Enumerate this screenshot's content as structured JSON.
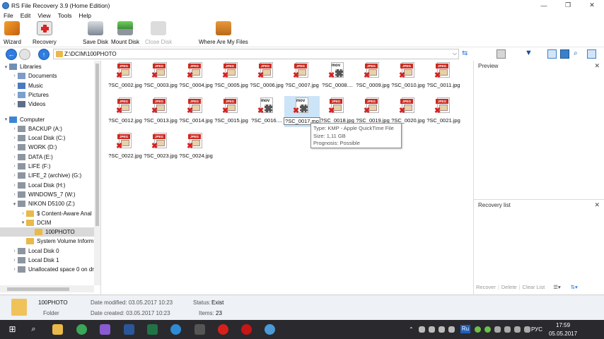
{
  "window": {
    "title": "RS File Recovery 3.9 (Home Edition)"
  },
  "menu": [
    "File",
    "Edit",
    "View",
    "Tools",
    "Help"
  ],
  "toolbar": {
    "wizard": "Wizard",
    "recovery": "Recovery",
    "save_disk": "Save Disk",
    "mount_disk": "Mount Disk",
    "close_disk": "Close Disk",
    "where_files": "Where Are My Files"
  },
  "address": {
    "path": "Z:\\DCIM\\100PHOTO"
  },
  "tree": [
    {
      "label": "Libraries",
      "arrow": "▾",
      "icon": "libraries-icon"
    },
    {
      "label": "Documents",
      "arrow": "›",
      "icon": "documents-icon"
    },
    {
      "label": "Music",
      "arrow": "›",
      "icon": "music-icon"
    },
    {
      "label": "Pictures",
      "arrow": "›",
      "icon": "pictures-icon"
    },
    {
      "label": "Videos",
      "arrow": "›",
      "icon": "videos-icon"
    },
    {
      "label": "Computer",
      "arrow": "▾",
      "icon": "computer-icon"
    },
    {
      "label": "BACKUP (A:)",
      "arrow": "›",
      "icon": "drive-icon"
    },
    {
      "label": "Local Disk (C:)",
      "arrow": "›",
      "icon": "drive-icon"
    },
    {
      "label": "WORK (D:)",
      "arrow": "›",
      "icon": "drive-icon"
    },
    {
      "label": "DATA (E:)",
      "arrow": "›",
      "icon": "drive-icon"
    },
    {
      "label": "LIFE (F:)",
      "arrow": "›",
      "icon": "drive-icon"
    },
    {
      "label": "LIFE_2 (archive) (G:)",
      "arrow": "›",
      "icon": "drive-icon"
    },
    {
      "label": "Local Disk (H:)",
      "arrow": "›",
      "icon": "drive-icon"
    },
    {
      "label": "WINDOWS_7 (W:)",
      "arrow": "›",
      "icon": "drive-icon"
    },
    {
      "label": "NIKON D5100 (Z:)",
      "arrow": "▾",
      "icon": "drive-icon"
    },
    {
      "label": "$ Content-Aware Anal",
      "arrow": "›",
      "icon": "folder-icon"
    },
    {
      "label": "DCIM",
      "arrow": "▾",
      "icon": "folder-icon"
    },
    {
      "label": "100PHOTO",
      "arrow": "",
      "icon": "folder-icon"
    },
    {
      "label": "System Volume Inform",
      "arrow": "",
      "icon": "folder-icon"
    },
    {
      "label": "Local Disk 0",
      "arrow": "›",
      "icon": "drive-icon"
    },
    {
      "label": "Local Disk 1",
      "arrow": "›",
      "icon": "drive-icon"
    },
    {
      "label": "Unallocated space 0 on dr",
      "arrow": "›",
      "icon": "drive-icon"
    }
  ],
  "files": [
    {
      "name": "?SC_0002.jpg",
      "kind": "JPEG"
    },
    {
      "name": "?SC_0003.jpg",
      "kind": "JPEG"
    },
    {
      "name": "?SC_0004.jpg",
      "kind": "JPEG"
    },
    {
      "name": "?SC_0005.jpg",
      "kind": "JPEG"
    },
    {
      "name": "?SC_0006.jpg",
      "kind": "JPEG"
    },
    {
      "name": "?SC_0007.jpg",
      "kind": "JPEG"
    },
    {
      "name": "?SC_0008....",
      "kind": "mov"
    },
    {
      "name": "?SC_0009.jpg",
      "kind": "JPEG"
    },
    {
      "name": "?SC_0010.jpg",
      "kind": "JPEG"
    },
    {
      "name": "?SC_0011.jpg",
      "kind": "JPEG"
    },
    {
      "name": "?SC_0012.jpg",
      "kind": "JPEG"
    },
    {
      "name": "?SC_0013.jpg",
      "kind": "JPEG"
    },
    {
      "name": "?SC_0014.jpg",
      "kind": "JPEG"
    },
    {
      "name": "?SC_0015.jpg",
      "kind": "JPEG"
    },
    {
      "name": "?SC_0016....",
      "kind": "mov"
    },
    {
      "name": "?SC_0017.mo",
      "kind": "mov"
    },
    {
      "name": "?SC_0018.jpg",
      "kind": "JPEG"
    },
    {
      "name": "?SC_0019.jpg",
      "kind": "JPEG"
    },
    {
      "name": "?SC_0020.jpg",
      "kind": "JPEG"
    },
    {
      "name": "?SC_0021.jpg",
      "kind": "JPEG"
    },
    {
      "name": "?SC_0022.jpg",
      "kind": "JPEG"
    },
    {
      "name": "?SC_0023.jpg",
      "kind": "JPEG"
    },
    {
      "name": "?SC_0024.jpg",
      "kind": "JPEG"
    }
  ],
  "tooltip": {
    "type": "Type: KMP - Apple QuickTime File",
    "size": "Size: 1,11 GB",
    "prognosis": "Prognosis: Possible"
  },
  "preview": {
    "title": "Preview"
  },
  "recovery_list": {
    "title": "Recovery list",
    "recover": "Recover",
    "delete": "Delete",
    "clear": "Clear List"
  },
  "status": {
    "name": "100PHOTO",
    "kind": "Folder",
    "modified": "Date modified: 03.05.2017 10:23",
    "created": "Date created: 03.05.2017 10:23",
    "status_label": "Status:",
    "status_value": "Exist",
    "items_label": "Items:",
    "items_value": "23"
  },
  "taskbar": {
    "lang": "РУС",
    "time": "17:59",
    "date": "05.05.2017",
    "ru_badge": "Ru"
  },
  "colors": {
    "accent": "#1e6fd0",
    "jpeg_band": "#cc2c22",
    "selection": "#cce4f7",
    "taskbar": "#2a2a2e"
  }
}
